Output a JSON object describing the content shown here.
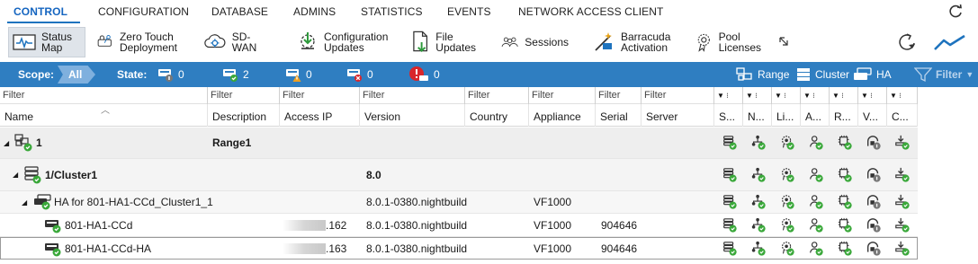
{
  "menu": {
    "items": [
      {
        "label": "CONTROL",
        "active": true
      },
      {
        "label": "CONFIGURATION"
      },
      {
        "label": "DATABASE"
      },
      {
        "label": "ADMINS"
      },
      {
        "label": "STATISTICS"
      },
      {
        "label": "EVENTS"
      },
      {
        "label": "NETWORK ACCESS CLIENT"
      }
    ],
    "refresh_icon": "refresh-icon",
    "accent": "#1565c0"
  },
  "toolbar": {
    "buttons": [
      {
        "label": "Status\nMap",
        "icon": "status-map-icon",
        "selected": true
      },
      {
        "label": "Zero Touch\nDeployment",
        "icon": "zero-touch-icon"
      },
      {
        "label": "SD-WAN",
        "icon": "sd-wan-icon"
      },
      {
        "label": "Configuration\nUpdates",
        "icon": "configuration-updates-icon"
      },
      {
        "label": "File\nUpdates",
        "icon": "file-updates-icon"
      },
      {
        "label": "Sessions",
        "icon": "sessions-icon"
      },
      {
        "label": "Barracuda\nActivation",
        "icon": "barracuda-activation-icon"
      },
      {
        "label": "Pool\nLicenses",
        "icon": "pool-licenses-icon"
      }
    ]
  },
  "scopebar": {
    "scope_label": "Scope:",
    "scope_value": "All",
    "state_label": "State:",
    "states": [
      {
        "icon": "state-unknown-icon",
        "count": "0"
      },
      {
        "icon": "state-ok-icon",
        "count": "2"
      },
      {
        "icon": "state-warning-icon",
        "count": "0"
      },
      {
        "icon": "state-error-icon",
        "count": "0"
      },
      {
        "icon": "state-pending-icon",
        "count": "0"
      }
    ],
    "range_label": "Range",
    "cluster_label": "Cluster",
    "ha_label": "HA",
    "filter_label": "Filter",
    "bar_color": "#2f7ec1"
  },
  "grid": {
    "filters": [
      "Filter",
      "Filter",
      "Filter",
      "Filter",
      "Filter",
      "Filter",
      "Filter",
      "Filter"
    ],
    "columns": [
      "Name",
      "Description",
      "Access IP",
      "Version",
      "Country",
      "Appliance",
      "Serial",
      "Server",
      "S...",
      "N...",
      "Li...",
      "A...",
      "R...",
      "V...",
      "C..."
    ],
    "rows": [
      {
        "name": "1",
        "description": "Range1",
        "access_ip": "",
        "version": "",
        "appliance": "",
        "serial": "",
        "level": "range"
      },
      {
        "name": "1/Cluster1",
        "description": "",
        "access_ip": "",
        "version": "8.0",
        "appliance": "",
        "serial": "",
        "level": "cluster"
      },
      {
        "name": "HA for 801-HA1-CCd_Cluster1_1",
        "description": "",
        "access_ip": "",
        "version": "8.0.1-0380.nightbuild",
        "appliance": "VF1000",
        "serial": "",
        "level": "ha"
      },
      {
        "name": "801-HA1-CCd",
        "description": "",
        "access_ip": ".162",
        "version": "8.0.1-0380.nightbuild",
        "appliance": "VF1000",
        "serial": "904646",
        "level": "box"
      },
      {
        "name": "801-HA1-CCd-HA",
        "description": "",
        "access_ip": ".163",
        "version": "8.0.1-0380.nightbuild",
        "appliance": "VF1000",
        "serial": "904646",
        "level": "box"
      }
    ],
    "status_icons": [
      "server-status-icon",
      "network-status-icon",
      "license-status-icon",
      "admin-status-icon",
      "resources-status-icon",
      "vpn-status-icon",
      "configuration-status-icon"
    ]
  }
}
